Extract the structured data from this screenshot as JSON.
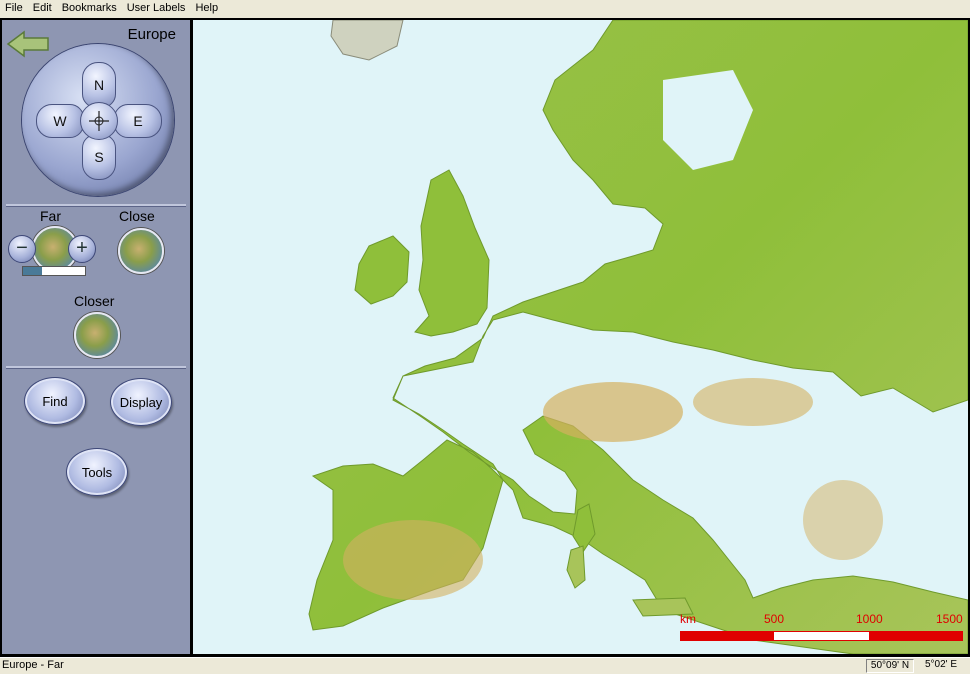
{
  "menubar": {
    "items": [
      "File",
      "Edit",
      "Bookmarks",
      "User Labels",
      "Help"
    ]
  },
  "sidebar": {
    "region_title": "Europe",
    "compass": {
      "north": "N",
      "south": "S",
      "west": "W",
      "east": "E"
    },
    "zoom": {
      "far_label": "Far",
      "close_label": "Close",
      "closer_label": "Closer",
      "level_fraction": 0.3
    },
    "buttons": {
      "find": "Find",
      "display": "Display",
      "tools": "Tools"
    }
  },
  "map": {
    "scale": {
      "unit": "km",
      "marks": [
        "500",
        "1000",
        "1500"
      ]
    },
    "colors": {
      "sea": "#e0f4f8",
      "lowland": "#8fbf3a",
      "upland": "#d4b060",
      "scale": "#e00000"
    }
  },
  "statusbar": {
    "view": "Europe - Far",
    "lat": "50°09' N",
    "lon": "5°02' E"
  }
}
